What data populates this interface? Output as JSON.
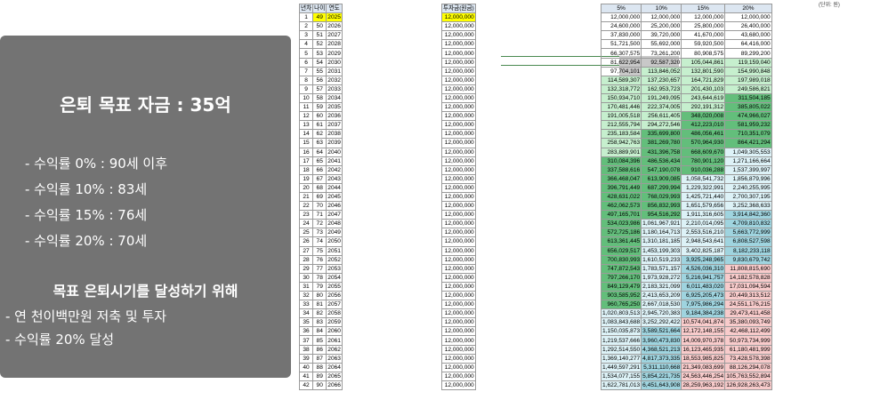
{
  "panel": {
    "title": "은퇴 목표 자금 : 35억",
    "rates": [
      "- 수익률   0% : 90세 이후",
      "- 수익률 10% : 83세",
      "- 수익률 15% : 76세",
      "- 수익률 20% : 70세"
    ],
    "goal_heading": "목표 은퇴시기를 달성하기 위해",
    "tasks": [
      "- 연 천이백만원 저축 및 투자",
      "- 수익률 20% 달성"
    ]
  },
  "sheet": {
    "corner_note": "(단위: 원)",
    "headers_left": [
      "년차",
      "나이",
      "연도"
    ],
    "header_invest": "투자금(원금)",
    "headers_rates": [
      "5%",
      "10%",
      "15%",
      "20%"
    ],
    "colors": {
      "header": "#dce6f1",
      "highlight": "#ffff00",
      "green_dark": "#63be7b",
      "green_light": "#c6efce",
      "blue_light": "#ddf2f7",
      "blue": "#9fd4df",
      "red_light": "#f8cbcb"
    },
    "rows": [
      [
        "1",
        "49",
        "2025",
        "12,000,000",
        "12,000,000",
        "12,000,000",
        "12,000,000",
        "12,000,000"
      ],
      [
        "2",
        "50",
        "2026",
        "12,000,000",
        "24,600,000",
        "25,200,000",
        "25,800,000",
        "26,400,000"
      ],
      [
        "3",
        "51",
        "2027",
        "12,000,000",
        "37,830,000",
        "39,720,000",
        "41,670,000",
        "43,680,000"
      ],
      [
        "4",
        "52",
        "2028",
        "12,000,000",
        "51,721,500",
        "55,692,000",
        "59,920,500",
        "64,416,000"
      ],
      [
        "5",
        "53",
        "2029",
        "12,000,000",
        "66,307,575",
        "73,261,200",
        "80,908,575",
        "89,299,200"
      ],
      [
        "6",
        "54",
        "2030",
        "12,000,000",
        "81,622,954",
        "92,587,320",
        "105,044,861",
        "119,159,040"
      ],
      [
        "7",
        "55",
        "2031",
        "12,000,000",
        "97,704,101",
        "113,846,052",
        "132,801,590",
        "154,990,848"
      ],
      [
        "8",
        "56",
        "2032",
        "12,000,000",
        "114,589,307",
        "137,230,657",
        "164,721,829",
        "197,989,018"
      ],
      [
        "9",
        "57",
        "2033",
        "12,000,000",
        "132,318,772",
        "162,953,723",
        "201,430,103",
        "249,586,821"
      ],
      [
        "10",
        "58",
        "2034",
        "12,000,000",
        "150,934,710",
        "191,249,095",
        "243,644,619",
        "311,504,185"
      ],
      [
        "11",
        "59",
        "2035",
        "12,000,000",
        "170,481,446",
        "222,374,005",
        "292,191,312",
        "385,805,022"
      ],
      [
        "12",
        "60",
        "2036",
        "12,000,000",
        "191,005,518",
        "256,611,405",
        "348,020,008",
        "474,966,027"
      ],
      [
        "13",
        "61",
        "2037",
        "12,000,000",
        "212,555,794",
        "294,272,546",
        "412,223,010",
        "581,959,232"
      ],
      [
        "14",
        "62",
        "2038",
        "12,000,000",
        "235,183,584",
        "335,699,800",
        "486,056,461",
        "710,351,079"
      ],
      [
        "15",
        "63",
        "2039",
        "12,000,000",
        "258,942,763",
        "381,269,780",
        "570,964,930",
        "864,421,294"
      ],
      [
        "16",
        "64",
        "2040",
        "12,000,000",
        "283,889,901",
        "431,396,758",
        "668,609,670",
        "1,049,305,553"
      ],
      [
        "17",
        "65",
        "2041",
        "12,000,000",
        "310,084,396",
        "486,536,434",
        "780,901,120",
        "1,271,166,664"
      ],
      [
        "18",
        "66",
        "2042",
        "12,000,000",
        "337,588,616",
        "547,190,078",
        "910,036,288",
        "1,537,399,997"
      ],
      [
        "19",
        "67",
        "2043",
        "12,000,000",
        "366,468,047",
        "613,909,085",
        "1,058,541,732",
        "1,856,879,996"
      ],
      [
        "20",
        "68",
        "2044",
        "12,000,000",
        "396,791,449",
        "687,299,994",
        "1,229,322,991",
        "2,240,255,995"
      ],
      [
        "21",
        "69",
        "2045",
        "12,000,000",
        "428,631,022",
        "768,029,993",
        "1,425,721,440",
        "2,700,307,195"
      ],
      [
        "22",
        "70",
        "2046",
        "12,000,000",
        "462,062,573",
        "856,832,993",
        "1,651,579,656",
        "3,252,368,633"
      ],
      [
        "23",
        "71",
        "2047",
        "12,000,000",
        "497,165,701",
        "954,516,292",
        "1,911,316,605",
        "3,914,842,360"
      ],
      [
        "24",
        "72",
        "2048",
        "12,000,000",
        "534,023,986",
        "1,061,967,921",
        "2,210,014,095",
        "4,709,810,832"
      ],
      [
        "25",
        "73",
        "2049",
        "12,000,000",
        "572,725,186",
        "1,180,164,713",
        "2,553,516,210",
        "5,663,772,999"
      ],
      [
        "26",
        "74",
        "2050",
        "12,000,000",
        "613,361,445",
        "1,310,181,185",
        "2,948,543,641",
        "6,808,527,598"
      ],
      [
        "27",
        "75",
        "2051",
        "12,000,000",
        "656,029,517",
        "1,453,199,303",
        "3,402,825,187",
        "8,182,233,118"
      ],
      [
        "28",
        "76",
        "2052",
        "12,000,000",
        "700,830,993",
        "1,610,519,233",
        "3,925,248,965",
        "9,830,679,742"
      ],
      [
        "29",
        "77",
        "2053",
        "12,000,000",
        "747,872,543",
        "1,783,571,157",
        "4,526,036,310",
        "11,808,815,690"
      ],
      [
        "30",
        "78",
        "2054",
        "12,000,000",
        "797,266,170",
        "1,973,928,272",
        "5,216,941,757",
        "14,182,578,828"
      ],
      [
        "31",
        "79",
        "2055",
        "12,000,000",
        "849,129,479",
        "2,183,321,099",
        "6,011,483,020",
        "17,031,094,594"
      ],
      [
        "32",
        "80",
        "2056",
        "12,000,000",
        "903,585,952",
        "2,413,653,209",
        "6,925,205,473",
        "20,449,313,512"
      ],
      [
        "33",
        "81",
        "2057",
        "12,000,000",
        "960,765,250",
        "2,667,018,530",
        "7,975,986,294",
        "24,551,176,215"
      ],
      [
        "34",
        "82",
        "2058",
        "12,000,000",
        "1,020,803,513",
        "2,945,720,383",
        "9,184,384,238",
        "29,473,411,458"
      ],
      [
        "35",
        "83",
        "2059",
        "12,000,000",
        "1,083,843,688",
        "3,252,292,422",
        "10,574,041,874",
        "35,380,093,749"
      ],
      [
        "36",
        "84",
        "2060",
        "12,000,000",
        "1,150,035,873",
        "3,589,521,664",
        "12,172,148,155",
        "42,468,112,499"
      ],
      [
        "37",
        "85",
        "2061",
        "12,000,000",
        "1,219,537,666",
        "3,960,473,830",
        "14,009,970,378",
        "50,973,734,999"
      ],
      [
        "38",
        "86",
        "2062",
        "12,000,000",
        "1,292,514,550",
        "4,368,521,213",
        "16,123,465,935",
        "61,180,481,999"
      ],
      [
        "39",
        "87",
        "2063",
        "12,000,000",
        "1,369,140,277",
        "4,817,373,335",
        "18,553,985,825",
        "73,428,578,398"
      ],
      [
        "40",
        "88",
        "2064",
        "12,000,000",
        "1,449,597,291",
        "5,311,110,668",
        "21,349,083,699",
        "88,126,294,078"
      ],
      [
        "41",
        "89",
        "2065",
        "12,000,000",
        "1,534,077,155",
        "5,854,221,735",
        "24,563,446,254",
        "105,763,552,894"
      ],
      [
        "42",
        "90",
        "2066",
        "12,000,000",
        "1,622,781,013",
        "6,451,643,908",
        "28,259,963,192",
        "126,928,263,473"
      ]
    ]
  }
}
